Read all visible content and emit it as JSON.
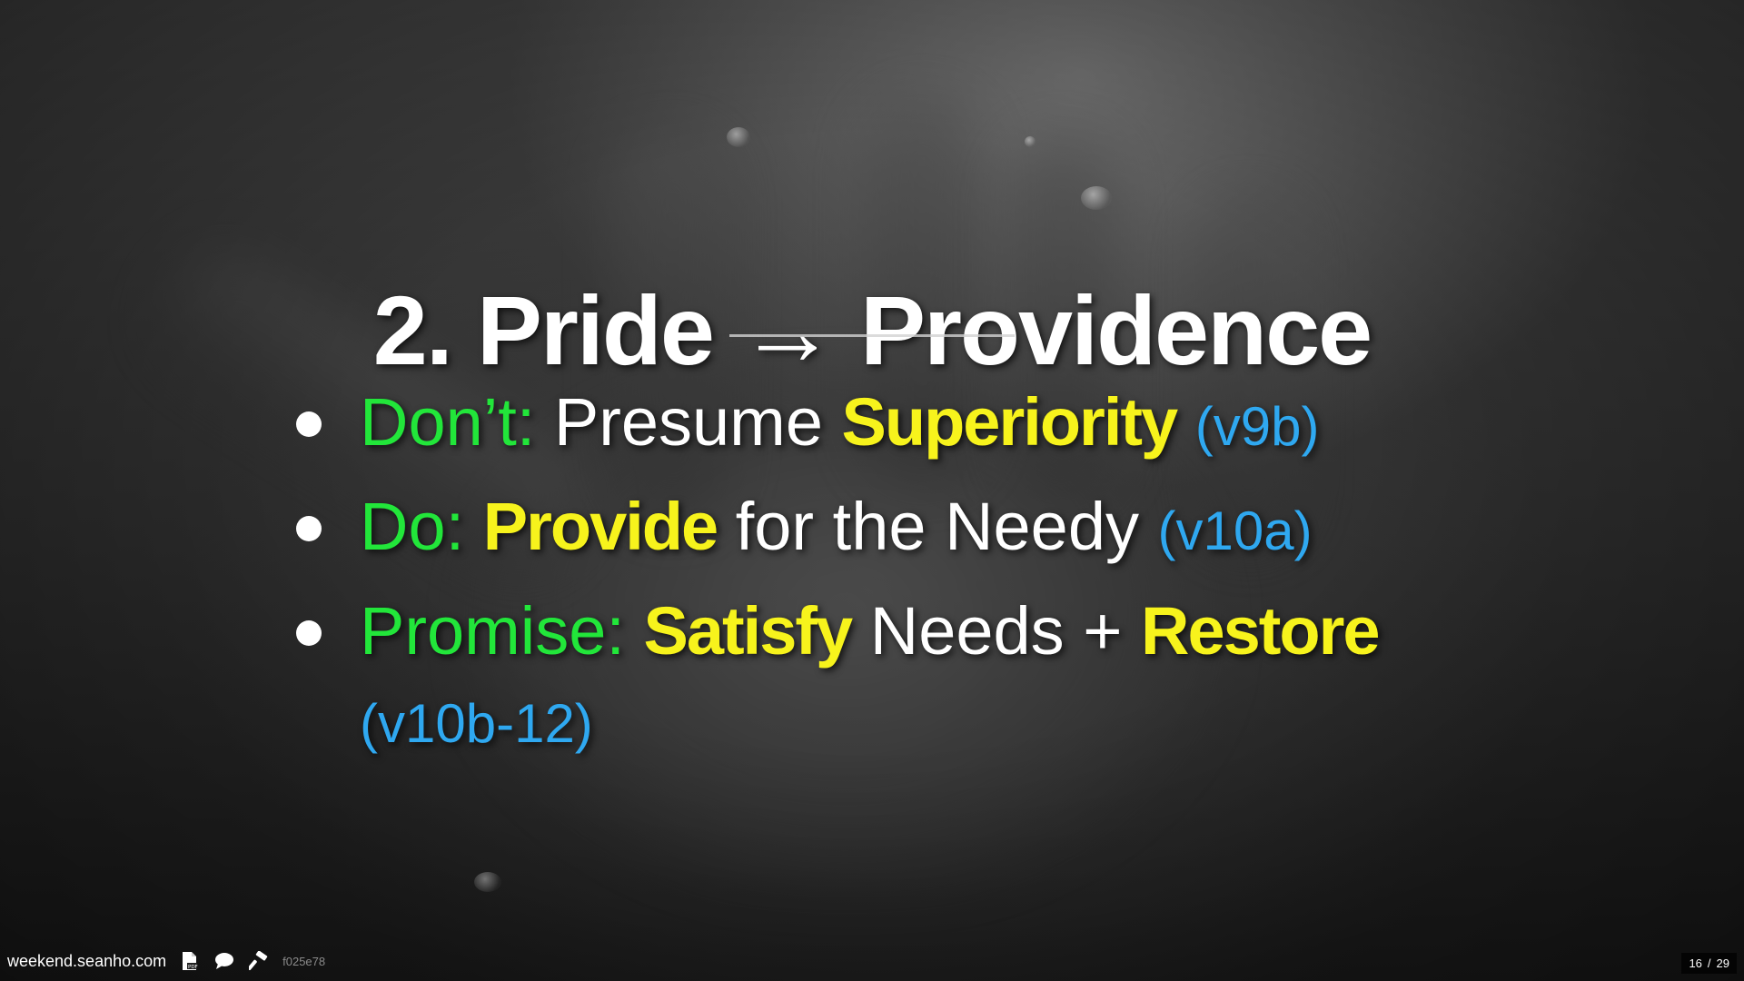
{
  "slide": {
    "title": "2. Pride → Providence",
    "bullets": [
      {
        "label": "Don’t:",
        "parts": [
          {
            "text": "Presume",
            "style": "plain"
          },
          {
            "text": "Superiority",
            "style": "highlight"
          }
        ],
        "ref": "(v9b)"
      },
      {
        "label": "Do:",
        "parts": [
          {
            "text": "Provide",
            "style": "highlight"
          },
          {
            "text": "for the Needy",
            "style": "plain"
          }
        ],
        "ref": "(v10a)"
      },
      {
        "label": "Promise:",
        "parts": [
          {
            "text": "Satisfy",
            "style": "highlight"
          },
          {
            "text": "Needs +",
            "style": "plain"
          },
          {
            "text": "Restore",
            "style": "highlight"
          }
        ],
        "ref": "(v10b-12)"
      }
    ]
  },
  "footer": {
    "site": "weekend.seanho.com",
    "commit": "f025e78",
    "icons": [
      "pdf-icon",
      "comment-icon",
      "hammer-icon"
    ]
  },
  "pager": {
    "current": "16",
    "separator": "/",
    "total": "29"
  },
  "colors": {
    "label_green": "#22e63a",
    "highlight_yellow": "#f7f31c",
    "reference_blue": "#2fa8f0",
    "text_white": "#ffffff"
  }
}
